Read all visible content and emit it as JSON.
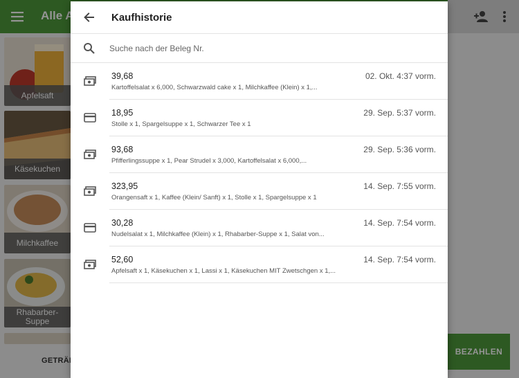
{
  "background": {
    "title": "Alle Ar",
    "tiles": [
      "Apfelsaft",
      "Käsekuchen",
      "Milchkaffee",
      "Rhabarber-\nSuppe"
    ],
    "tab_label": "GETRÄNK",
    "pay_label": "BEZAHLEN",
    "accent_color": "#4e9a3c"
  },
  "dialog": {
    "title": "Kaufhistorie",
    "search_placeholder": "Suche nach der Beleg Nr.",
    "search_value": ""
  },
  "receipts": [
    {
      "amount": "39,68",
      "items": "Kartoffelsalat x 6,000, Schwarzwald cake x 1, Milchkaffee (Klein) x 1,...",
      "date": "02. Okt. 4:37 vorm.",
      "payment": "cash-icon"
    },
    {
      "amount": "18,95",
      "items": "Stolle x 1, Spargelsuppe x 1, Schwarzer Tee x 1",
      "date": "29. Sep. 5:37 vorm.",
      "payment": "card-icon"
    },
    {
      "amount": "93,68",
      "items": "Pfifferlingssuppe x 1, Pear Strudel x 3,000, Kartoffelsalat x 6,000,...",
      "date": "29. Sep. 5:36 vorm.",
      "payment": "cash-icon"
    },
    {
      "amount": "323,95",
      "items": "Orangensaft x 1, Kaffee (Klein/ Sanft) x 1, Stolle x 1, Spargelsuppe x 1",
      "date": "14. Sep. 7:55 vorm.",
      "payment": "cash-icon"
    },
    {
      "amount": "30,28",
      "items": "Nudelsalat x 1, Milchkaffee (Klein) x 1, Rhabarber-Suppe x 1, Salat von...",
      "date": "14. Sep. 7:54 vorm.",
      "payment": "card-icon"
    },
    {
      "amount": "52,60",
      "items": "Apfelsaft x 1, Käsekuchen x 1, Lassi x 1, Käsekuchen MIT Zwetschgen x 1,...",
      "date": "14. Sep. 7:54 vorm.",
      "payment": "cash-icon"
    }
  ]
}
